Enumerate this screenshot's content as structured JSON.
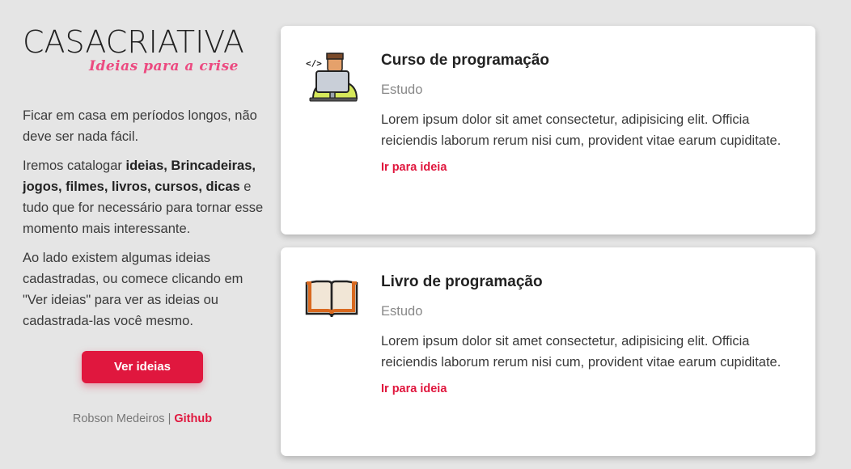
{
  "brand": {
    "logo_strong": "CASA",
    "logo_light": "CRIATIVA",
    "tagline": "Ideias para a crise",
    "accent_color": "#e0173e",
    "tagline_color": "#ec4a80"
  },
  "sidebar": {
    "p1": "Ficar em casa em períodos longos, não deve ser nada fácil.",
    "p2_prefix": "Iremos catalogar ",
    "p2_bold": "ideias, Brincadeiras, jogos, filmes, livros, cursos, dicas",
    "p2_suffix": " e tudo que for necessário para tornar esse momento mais interessante.",
    "p3": "Ao lado existem algumas ideias cadastradas, ou comece clicando em \"Ver ideias\" para ver as ideias ou cadastrada-las você mesmo.",
    "button_label": "Ver ideias",
    "footer_author": "Robson Medeiros",
    "footer_sep": " | ",
    "footer_link": "Github"
  },
  "ideas": [
    {
      "title": "Curso de programação",
      "category": "Estudo",
      "description": "Lorem ipsum dolor sit amet consectetur, adipisicing elit. Officia reiciendis laborum rerum nisi cum, provident vitae earum cupiditate.",
      "link": "Ir para ideia",
      "icon": "programmer-laptop-icon"
    },
    {
      "title": "Livro de programação",
      "category": "Estudo",
      "description": "Lorem ipsum dolor sit amet consectetur, adipisicing elit. Officia reiciendis laborum rerum nisi cum, provident vitae earum cupiditate.",
      "link": "Ir para ideia",
      "icon": "open-book-icon"
    }
  ]
}
